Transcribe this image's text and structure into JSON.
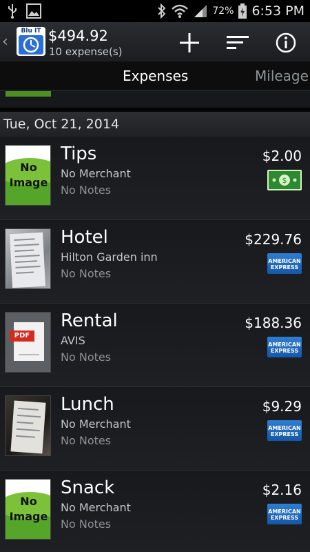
{
  "status_bar": {
    "battery_percent": "72%",
    "time": "6:53 PM",
    "icons": [
      "usb-icon",
      "image-icon",
      "bluetooth-icon",
      "wifi-icon",
      "signal-icon",
      "battery-icon"
    ]
  },
  "action_bar": {
    "logo_text": "Blu IT",
    "total": "$494.92",
    "count": "10 expense(s)",
    "icons": [
      "back-chevron-icon",
      "add-icon",
      "sort-icon",
      "info-icon"
    ]
  },
  "tabs": [
    {
      "label": "Expenses",
      "selected": true
    },
    {
      "label": "Mileage",
      "selected": false
    }
  ],
  "date_header": "Tue, Oct 21, 2014",
  "expenses": [
    {
      "title": "Tips",
      "merchant": "No Merchant",
      "notes": "No Notes",
      "amount": "$2.00",
      "payment_icon": "cash-icon",
      "thumbnail": "no-image",
      "thumb_text_1": "No",
      "thumb_text_2": "Image"
    },
    {
      "title": "Hotel",
      "merchant": "Hilton Garden inn",
      "notes": "No Notes",
      "amount": "$229.76",
      "payment_icon": "amex-icon",
      "thumbnail": "receipt-photo",
      "amex_text_1": "AMERICAN",
      "amex_text_2": "EXPRESS"
    },
    {
      "title": "Rental",
      "merchant": "AVIS",
      "notes": "No Notes",
      "amount": "$188.36",
      "payment_icon": "amex-icon",
      "thumbnail": "pdf",
      "pdf_label": "PDF",
      "amex_text_1": "AMERICAN",
      "amex_text_2": "EXPRESS"
    },
    {
      "title": "Lunch",
      "merchant": "No Merchant",
      "notes": "No Notes",
      "amount": "$9.29",
      "payment_icon": "amex-icon",
      "thumbnail": "receipt-photo",
      "amex_text_1": "AMERICAN",
      "amex_text_2": "EXPRESS"
    },
    {
      "title": "Snack",
      "merchant": "No Merchant",
      "notes": "No Notes",
      "amount": "$2.16",
      "payment_icon": "amex-icon",
      "thumbnail": "no-image",
      "thumb_text_1": "No",
      "thumb_text_2": "Image",
      "amex_text_1": "AMERICAN",
      "amex_text_2": "EXPRESS"
    }
  ]
}
